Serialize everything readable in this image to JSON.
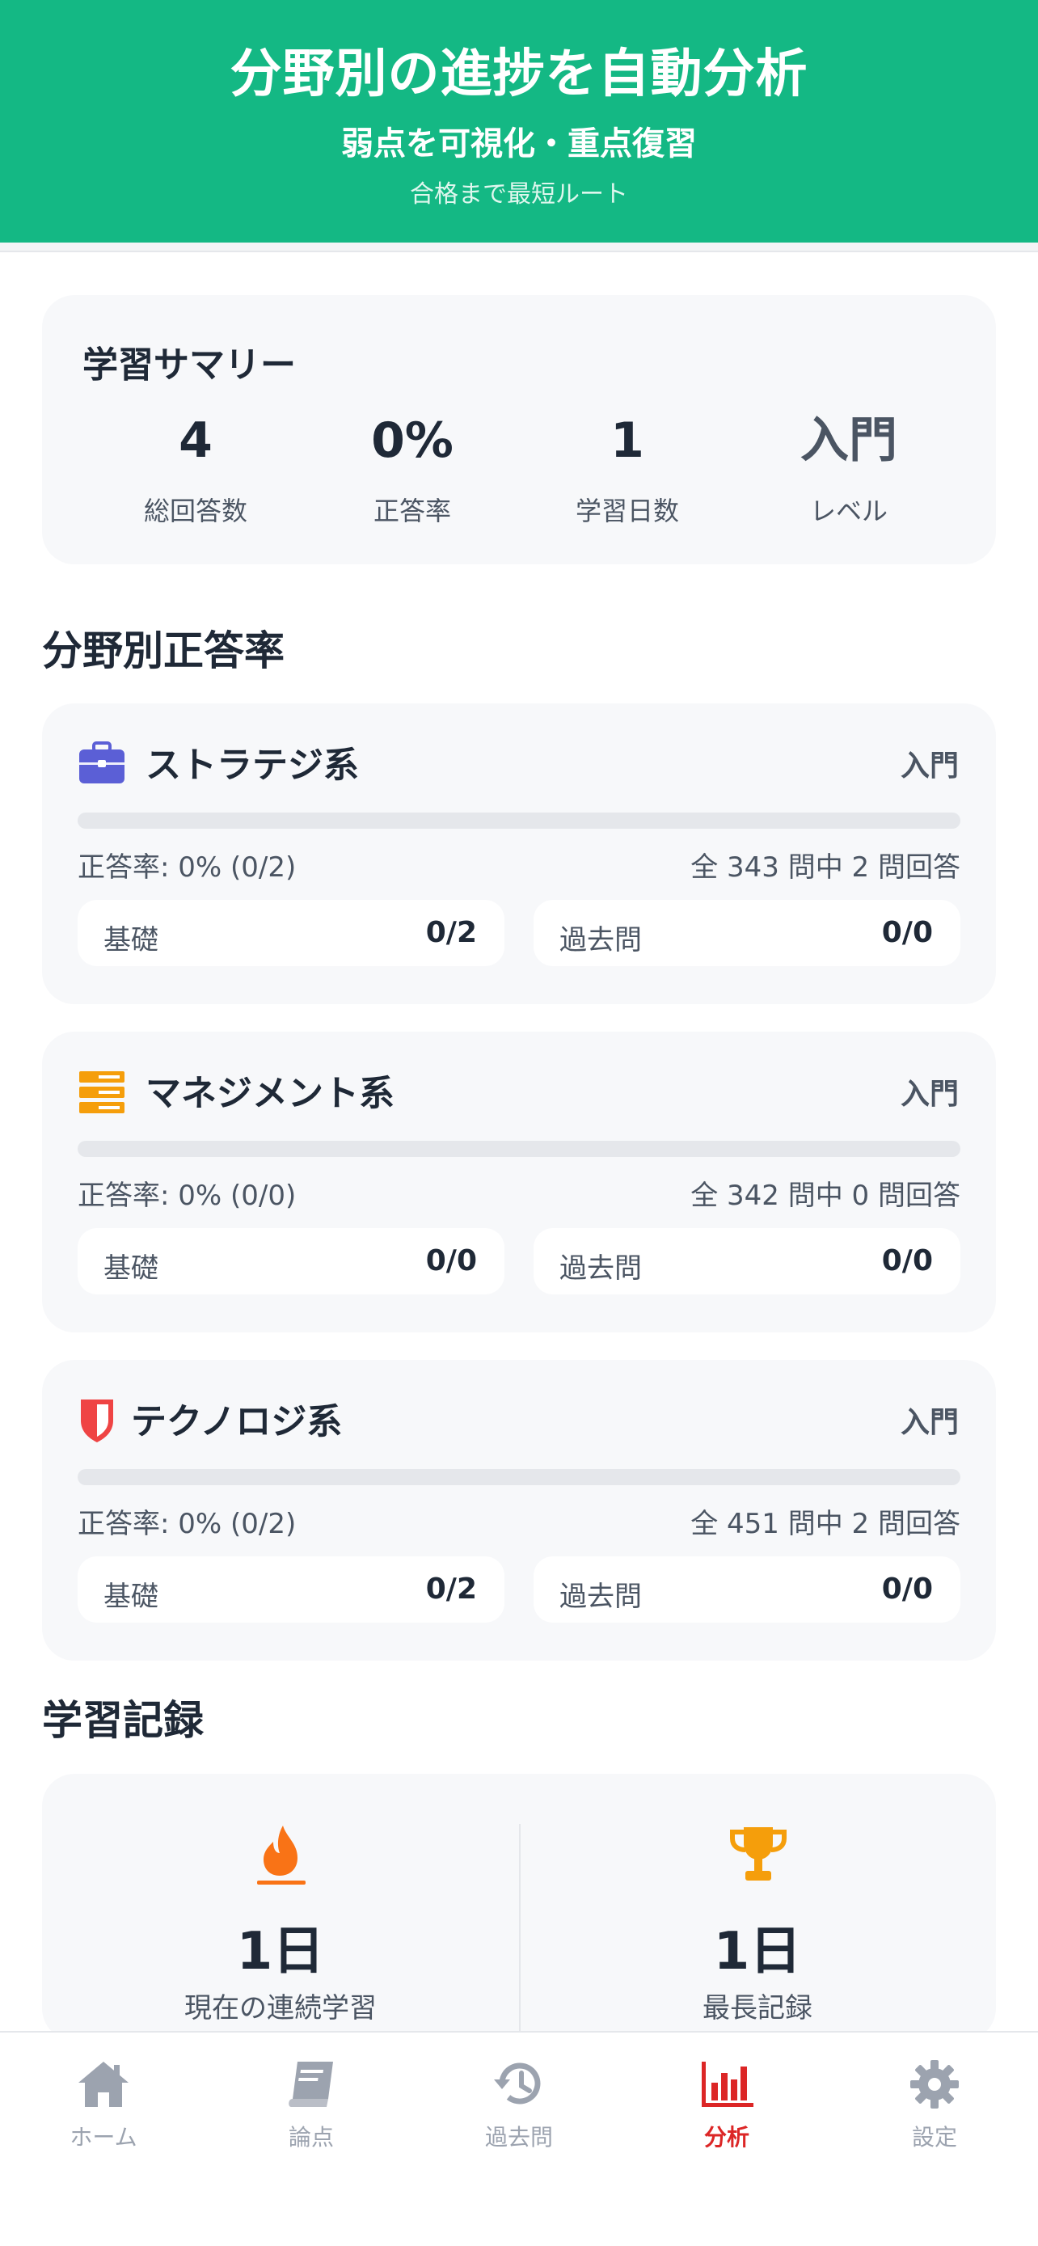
{
  "hero": {
    "title": "分野別の進捗を自動分析",
    "subtitle": "弱点を可視化・重点復習",
    "note": "合格まで最短ルート"
  },
  "summary": {
    "title": "学習サマリー",
    "stats": [
      {
        "value": "4",
        "label": "総回答数"
      },
      {
        "value": "0%",
        "label": "正答率"
      },
      {
        "value": "1",
        "label": "学習日数"
      },
      {
        "value": "入門",
        "label": "レベル"
      }
    ]
  },
  "subjects_title": "分野別正答率",
  "subjects": [
    {
      "icon": "briefcase-icon",
      "color": "#5b5fd6",
      "name": "ストラテジ系",
      "level": "入門",
      "progress": 0,
      "rate": "正答率: 0% (0/2)",
      "count": "全 343 問中 2 問回答",
      "basic_label": "基礎",
      "basic_value": "0/2",
      "past_label": "過去問",
      "past_value": "0/0"
    },
    {
      "icon": "server-icon",
      "color": "#f59e0b",
      "name": "マネジメント系",
      "level": "入門",
      "progress": 0,
      "rate": "正答率: 0% (0/0)",
      "count": "全 342 問中 0 問回答",
      "basic_label": "基礎",
      "basic_value": "0/0",
      "past_label": "過去問",
      "past_value": "0/0"
    },
    {
      "icon": "shield-icon",
      "color": "#ef4444",
      "name": "テクノロジ系",
      "level": "入門",
      "progress": 0,
      "rate": "正答率: 0% (0/2)",
      "count": "全 451 問中 2 問回答",
      "basic_label": "基礎",
      "basic_value": "0/2",
      "past_label": "過去問",
      "past_value": "0/0"
    }
  ],
  "records_title": "学習記録",
  "records": [
    {
      "icon": "flame-icon",
      "value": "1日",
      "label": "現在の連続学習"
    },
    {
      "icon": "trophy-icon",
      "value": "1日",
      "label": "最長記録"
    }
  ],
  "tabs": [
    {
      "icon": "home-icon",
      "label": "ホーム",
      "active": false
    },
    {
      "icon": "book-icon",
      "label": "論点",
      "active": false
    },
    {
      "icon": "history-icon",
      "label": "過去問",
      "active": false
    },
    {
      "icon": "chart-icon",
      "label": "分析",
      "active": true
    },
    {
      "icon": "gear-icon",
      "label": "設定",
      "active": false
    }
  ],
  "colors": {
    "accent": "#14b884",
    "active_tab": "#dc2626",
    "inactive_tab": "#9ca3af"
  }
}
